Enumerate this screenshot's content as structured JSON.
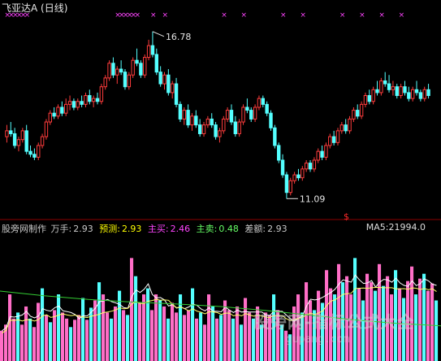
{
  "header": {
    "title": "飞亚达A (日线)"
  },
  "info_bar": {
    "source_label": "股旁网制作",
    "wanshou_label": "万手:",
    "wanshou_value": "2.93",
    "yuce_label": "预测:",
    "yuce_value": "2.93",
    "zhumai_buy_label": "主买:",
    "zhumai_buy_value": "2.46",
    "zhumai_sell_label": "主卖:",
    "zhumai_sell_value": "0.48",
    "chae_label": "差额:",
    "chae_value": "2.93",
    "ma5_label": "MA5:",
    "ma5_value": "21994.0"
  },
  "watermark": {
    "text": "股旁网-指标公式大全",
    "url": "gupang.com"
  },
  "colors": {
    "up": "#ff3c3c",
    "down": "#54ffff",
    "vol_up": "#ff6ec7",
    "vol_down": "#54ffff",
    "ma_white": "#ffffff",
    "ma_yellow": "#ffff66",
    "ma_green": "#33cc33",
    "marker": "#ff44ff",
    "separator": "#8b0000",
    "buy": "#ff44ff",
    "sell": "#66ff66",
    "yuce": "#ffff00"
  },
  "chart_data": {
    "type": "candlestick",
    "annotations": {
      "high_label": "16.78",
      "low_label": "11.09",
      "signal_glyph": "$"
    },
    "price": {
      "ylim": [
        10.6,
        17.3
      ],
      "candles": [
        [
          13.2,
          13.6,
          13.0,
          13.4
        ],
        [
          13.4,
          13.7,
          13.2,
          13.3
        ],
        [
          13.3,
          13.5,
          12.8,
          12.9
        ],
        [
          12.9,
          13.2,
          12.7,
          13.1
        ],
        [
          13.1,
          13.5,
          13.0,
          13.4
        ],
        [
          13.4,
          13.6,
          12.6,
          12.7
        ],
        [
          12.7,
          12.9,
          12.5,
          12.6
        ],
        [
          12.6,
          12.8,
          12.4,
          12.5
        ],
        [
          12.5,
          13.0,
          12.4,
          12.9
        ],
        [
          12.9,
          13.3,
          12.8,
          13.2
        ],
        [
          13.2,
          13.8,
          13.1,
          13.7
        ],
        [
          13.7,
          14.1,
          13.6,
          14.0
        ],
        [
          14.0,
          14.2,
          13.8,
          13.9
        ],
        [
          13.9,
          14.3,
          13.8,
          14.2
        ],
        [
          14.2,
          14.4,
          13.9,
          14.0
        ],
        [
          14.0,
          14.5,
          13.9,
          14.3
        ],
        [
          14.3,
          14.6,
          14.1,
          14.4
        ],
        [
          14.4,
          14.5,
          14.1,
          14.2
        ],
        [
          14.2,
          14.5,
          14.1,
          14.4
        ],
        [
          14.4,
          14.6,
          14.2,
          14.3
        ],
        [
          14.3,
          14.7,
          14.2,
          14.6
        ],
        [
          14.6,
          14.8,
          14.3,
          14.4
        ],
        [
          14.4,
          14.6,
          14.2,
          14.5
        ],
        [
          14.5,
          14.7,
          14.3,
          14.4
        ],
        [
          14.4,
          15.0,
          14.3,
          14.9
        ],
        [
          14.9,
          15.3,
          14.8,
          15.2
        ],
        [
          15.2,
          15.8,
          15.1,
          15.7
        ],
        [
          15.7,
          15.9,
          15.2,
          15.3
        ],
        [
          15.3,
          15.6,
          15.0,
          15.5
        ],
        [
          15.5,
          15.8,
          15.3,
          15.4
        ],
        [
          15.4,
          15.5,
          14.8,
          14.9
        ],
        [
          14.9,
          15.4,
          14.8,
          15.3
        ],
        [
          15.3,
          15.9,
          15.2,
          15.8
        ],
        [
          15.8,
          16.2,
          15.6,
          15.7
        ],
        [
          15.7,
          15.8,
          15.2,
          15.3
        ],
        [
          15.3,
          16.0,
          15.2,
          15.9
        ],
        [
          15.9,
          16.5,
          15.8,
          16.3
        ],
        [
          16.3,
          16.78,
          15.9,
          16.0
        ],
        [
          16.0,
          16.2,
          15.3,
          15.4
        ],
        [
          15.4,
          15.6,
          14.9,
          15.0
        ],
        [
          15.0,
          15.4,
          14.8,
          15.3
        ],
        [
          15.3,
          15.5,
          14.6,
          14.7
        ],
        [
          14.7,
          15.1,
          14.5,
          15.0
        ],
        [
          15.0,
          15.2,
          14.2,
          14.3
        ],
        [
          14.3,
          14.4,
          13.7,
          13.8
        ],
        [
          13.8,
          14.2,
          13.6,
          14.1
        ],
        [
          14.1,
          14.3,
          13.5,
          13.6
        ],
        [
          13.6,
          14.0,
          13.4,
          13.9
        ],
        [
          13.9,
          14.1,
          13.5,
          13.6
        ],
        [
          13.6,
          13.8,
          13.2,
          13.3
        ],
        [
          13.3,
          13.7,
          13.2,
          13.6
        ],
        [
          13.6,
          13.9,
          13.5,
          13.8
        ],
        [
          13.8,
          14.0,
          13.5,
          13.6
        ],
        [
          13.6,
          13.7,
          13.1,
          13.2
        ],
        [
          13.2,
          13.5,
          13.0,
          13.4
        ],
        [
          13.4,
          13.9,
          13.3,
          13.8
        ],
        [
          13.8,
          14.2,
          13.7,
          14.1
        ],
        [
          14.1,
          14.3,
          13.6,
          13.7
        ],
        [
          13.7,
          13.9,
          13.2,
          13.3
        ],
        [
          13.3,
          13.8,
          13.2,
          13.7
        ],
        [
          13.7,
          14.3,
          13.6,
          14.2
        ],
        [
          14.2,
          14.5,
          14.0,
          14.1
        ],
        [
          14.1,
          14.2,
          13.7,
          13.8
        ],
        [
          13.8,
          14.3,
          13.7,
          14.2
        ],
        [
          14.2,
          14.6,
          14.1,
          14.5
        ],
        [
          14.5,
          14.6,
          14.2,
          14.3
        ],
        [
          14.3,
          14.4,
          13.9,
          14.0
        ],
        [
          14.0,
          14.1,
          13.4,
          13.5
        ],
        [
          13.5,
          13.6,
          12.8,
          12.9
        ],
        [
          12.9,
          13.0,
          12.3,
          12.4
        ],
        [
          12.4,
          12.6,
          11.8,
          11.9
        ],
        [
          11.9,
          12.0,
          11.09,
          11.3
        ],
        [
          11.3,
          11.8,
          11.2,
          11.7
        ],
        [
          11.7,
          12.0,
          11.6,
          11.9
        ],
        [
          11.9,
          12.1,
          11.7,
          11.8
        ],
        [
          11.8,
          12.2,
          11.7,
          12.1
        ],
        [
          12.1,
          12.4,
          12.0,
          12.3
        ],
        [
          12.3,
          12.4,
          12.0,
          12.1
        ],
        [
          12.1,
          12.5,
          12.0,
          12.4
        ],
        [
          12.4,
          12.8,
          12.3,
          12.7
        ],
        [
          12.7,
          12.9,
          12.4,
          12.5
        ],
        [
          12.5,
          13.0,
          12.4,
          12.9
        ],
        [
          12.9,
          13.3,
          12.8,
          13.2
        ],
        [
          13.2,
          13.4,
          12.9,
          13.0
        ],
        [
          13.0,
          13.5,
          12.9,
          13.4
        ],
        [
          13.4,
          13.7,
          13.3,
          13.6
        ],
        [
          13.6,
          13.8,
          13.3,
          13.4
        ],
        [
          13.4,
          13.9,
          13.3,
          13.8
        ],
        [
          13.8,
          14.2,
          13.7,
          14.1
        ],
        [
          14.1,
          14.3,
          13.8,
          13.9
        ],
        [
          13.9,
          14.4,
          13.8,
          14.3
        ],
        [
          14.3,
          14.7,
          14.2,
          14.6
        ],
        [
          14.6,
          14.8,
          14.3,
          14.4
        ],
        [
          14.4,
          14.9,
          14.3,
          14.8
        ],
        [
          14.8,
          15.1,
          14.6,
          14.7
        ],
        [
          14.7,
          15.2,
          14.6,
          15.1
        ],
        [
          15.1,
          15.4,
          14.9,
          15.0
        ],
        [
          15.0,
          15.3,
          14.7,
          14.8
        ],
        [
          14.8,
          15.1,
          14.6,
          14.9
        ],
        [
          14.9,
          15.0,
          14.5,
          14.6
        ],
        [
          14.6,
          15.0,
          14.5,
          14.9
        ],
        [
          14.9,
          15.1,
          14.6,
          14.7
        ],
        [
          14.7,
          14.9,
          14.4,
          14.5
        ],
        [
          14.5,
          14.9,
          14.4,
          14.8
        ],
        [
          14.8,
          15.1,
          14.6,
          14.7
        ],
        [
          14.7,
          14.8,
          14.4,
          14.5
        ],
        [
          14.5,
          14.9,
          14.4,
          14.8
        ],
        [
          14.8,
          15.0,
          14.5,
          14.6
        ]
      ],
      "high_index": 37,
      "low_index": 71,
      "markers_top": [
        0,
        1,
        2,
        3,
        4,
        5,
        28,
        29,
        30,
        31,
        32,
        33,
        37,
        40,
        55,
        60,
        70,
        75,
        85,
        90,
        95,
        100
      ]
    },
    "volume": {
      "series": [
        {
          "name": "MA5",
          "values": [
            21994.0
          ]
        }
      ],
      "bars": [
        [
          0.25,
          1
        ],
        [
          0.3,
          1
        ],
        [
          0.55,
          1
        ],
        [
          0.35,
          1
        ],
        [
          0.4,
          0
        ],
        [
          0.3,
          1
        ],
        [
          0.45,
          1
        ],
        [
          0.35,
          0
        ],
        [
          0.28,
          1
        ],
        [
          0.48,
          1
        ],
        [
          0.6,
          0
        ],
        [
          0.38,
          1
        ],
        [
          0.32,
          0
        ],
        [
          0.42,
          1
        ],
        [
          0.55,
          0
        ],
        [
          0.4,
          1
        ],
        [
          0.35,
          1
        ],
        [
          0.28,
          0
        ],
        [
          0.34,
          1
        ],
        [
          0.38,
          1
        ],
        [
          0.52,
          0
        ],
        [
          0.34,
          1
        ],
        [
          0.44,
          0
        ],
        [
          0.5,
          1
        ],
        [
          0.65,
          0
        ],
        [
          0.55,
          1
        ],
        [
          0.4,
          1
        ],
        [
          0.35,
          0
        ],
        [
          0.45,
          1
        ],
        [
          0.58,
          0
        ],
        [
          0.42,
          1
        ],
        [
          0.38,
          0
        ],
        [
          0.85,
          1
        ],
        [
          0.7,
          0
        ],
        [
          0.48,
          1
        ],
        [
          0.55,
          1
        ],
        [
          0.6,
          0
        ],
        [
          0.42,
          1
        ],
        [
          0.55,
          1
        ],
        [
          0.5,
          0
        ],
        [
          0.45,
          1
        ],
        [
          0.35,
          0
        ],
        [
          0.48,
          1
        ],
        [
          0.4,
          1
        ],
        [
          0.55,
          0
        ],
        [
          0.38,
          1
        ],
        [
          0.42,
          1
        ],
        [
          0.6,
          0
        ],
        [
          0.35,
          1
        ],
        [
          0.4,
          0
        ],
        [
          0.3,
          1
        ],
        [
          0.55,
          1
        ],
        [
          0.45,
          0
        ],
        [
          0.35,
          1
        ],
        [
          0.38,
          0
        ],
        [
          0.5,
          1
        ],
        [
          0.42,
          1
        ],
        [
          0.35,
          0
        ],
        [
          0.45,
          1
        ],
        [
          0.3,
          0
        ],
        [
          0.52,
          1
        ],
        [
          0.4,
          1
        ],
        [
          0.35,
          0
        ],
        [
          0.45,
          1
        ],
        [
          0.3,
          0
        ],
        [
          0.4,
          1
        ],
        [
          0.38,
          1
        ],
        [
          0.55,
          0
        ],
        [
          0.42,
          1
        ],
        [
          0.3,
          0
        ],
        [
          0.25,
          1
        ],
        [
          0.22,
          0
        ],
        [
          0.45,
          1
        ],
        [
          0.55,
          1
        ],
        [
          0.4,
          0
        ],
        [
          0.65,
          1
        ],
        [
          0.5,
          1
        ],
        [
          0.42,
          0
        ],
        [
          0.58,
          1
        ],
        [
          0.48,
          0
        ],
        [
          0.75,
          1
        ],
        [
          0.6,
          1
        ],
        [
          0.55,
          0
        ],
        [
          0.8,
          1
        ],
        [
          0.65,
          0
        ],
        [
          0.7,
          1
        ],
        [
          0.55,
          1
        ],
        [
          0.85,
          0
        ],
        [
          0.6,
          1
        ],
        [
          0.5,
          0
        ],
        [
          0.72,
          1
        ],
        [
          0.65,
          1
        ],
        [
          0.58,
          0
        ],
        [
          0.8,
          1
        ],
        [
          0.62,
          0
        ],
        [
          0.7,
          1
        ],
        [
          0.55,
          1
        ],
        [
          0.75,
          0
        ],
        [
          0.6,
          1
        ],
        [
          0.52,
          0
        ],
        [
          0.66,
          1
        ],
        [
          0.78,
          1
        ],
        [
          0.55,
          0
        ],
        [
          0.68,
          1
        ],
        [
          0.72,
          0
        ],
        [
          0.58,
          1
        ],
        [
          0.64,
          1
        ],
        [
          0.5,
          0
        ]
      ]
    }
  }
}
